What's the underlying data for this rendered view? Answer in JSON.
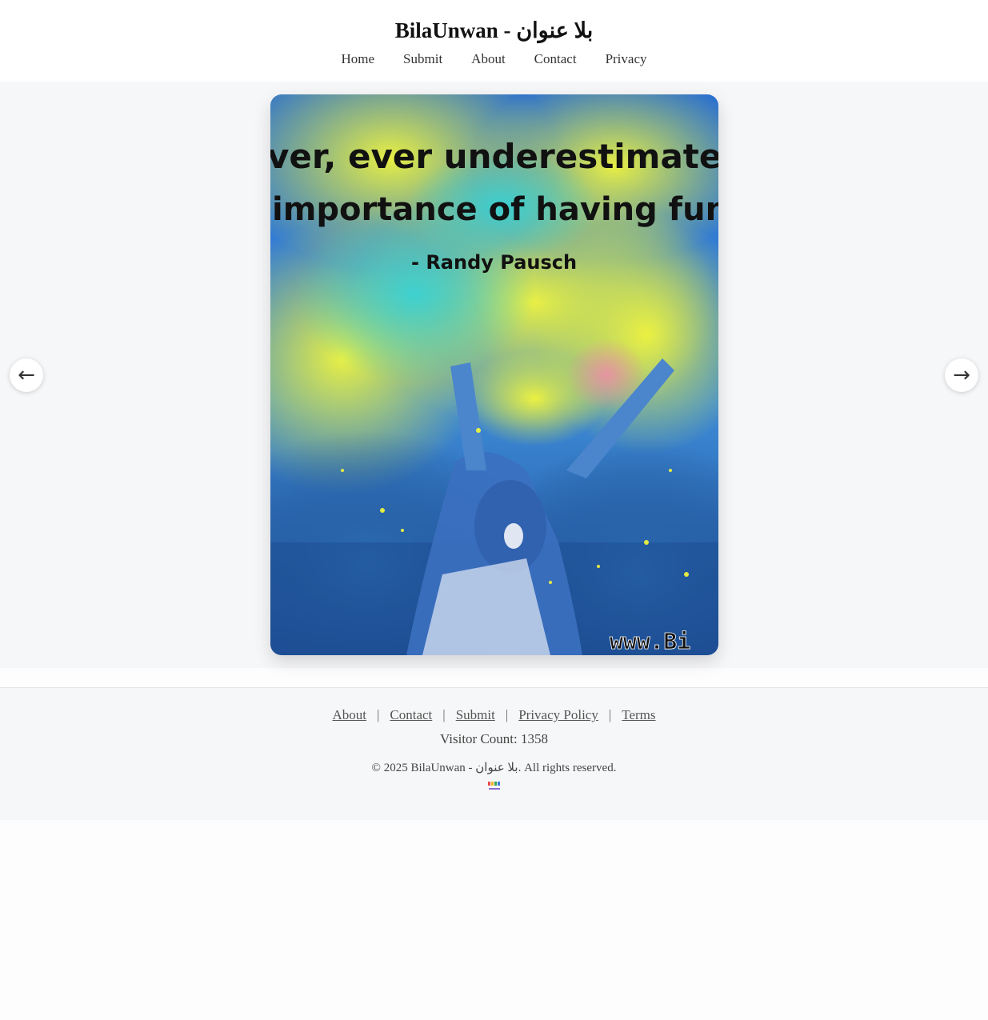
{
  "header": {
    "title": "BilaUnwan - بلا عنوان",
    "nav": [
      "Home",
      "Submit",
      "About",
      "Contact",
      "Privacy"
    ]
  },
  "slider": {
    "image_quote_lines": [
      "ver, ever underestimate t",
      "importance of having fun.",
      "- Randy Pausch"
    ],
    "image_watermark": "www.Bi",
    "prev_icon": "←",
    "next_icon": "→"
  },
  "footer": {
    "links": [
      "About",
      "Contact",
      "Submit",
      "Privacy Policy",
      "Terms"
    ],
    "separator": "|",
    "visitor_count": "Visitor Count: 1358",
    "copyright": "© 2025 BilaUnwan - بلا عنوان. All rights reserved."
  },
  "colors": {
    "background": "#f6f7f8",
    "accent_yellow": "#e6ef3a",
    "accent_cyan": "#2fc4d6",
    "sky_blue": "#2a6fd0"
  },
  "icons": {
    "prev": "arrow-left-icon",
    "next": "arrow-right-icon",
    "footer_logo": "site-logo-icon"
  }
}
